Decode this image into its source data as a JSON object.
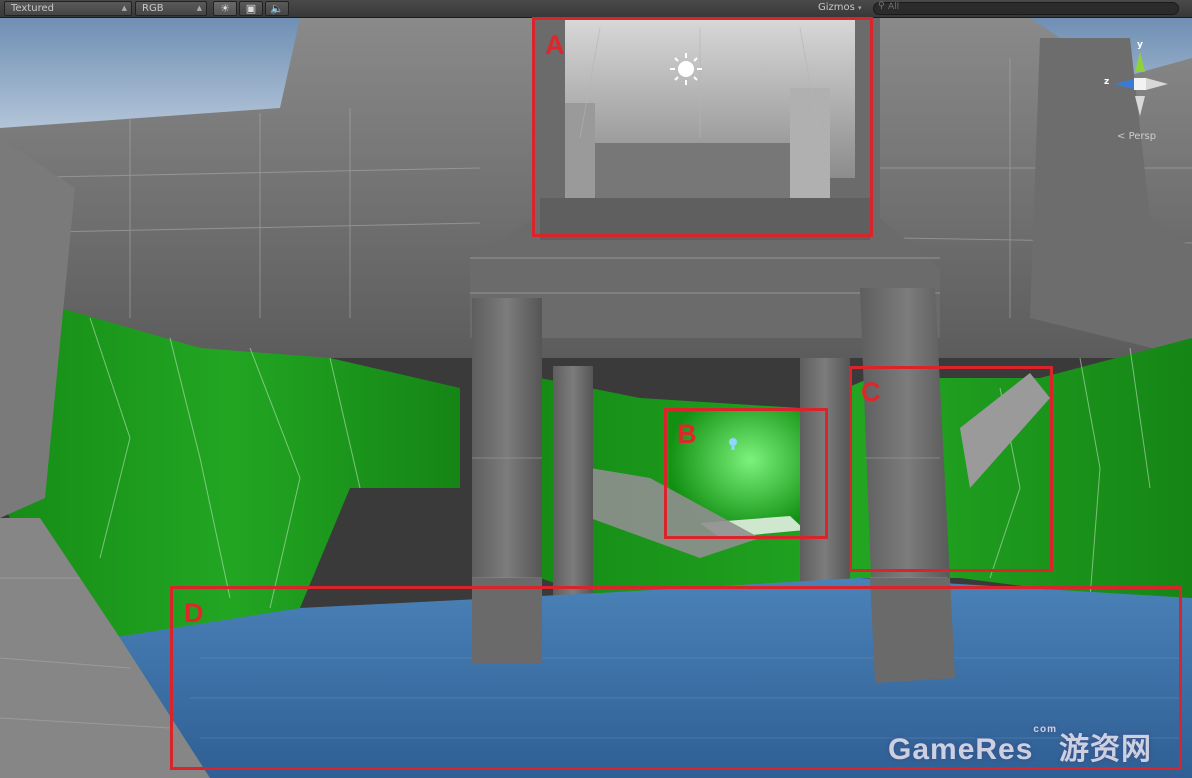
{
  "toolbar": {
    "render_mode": "Textured",
    "color_channel": "RGB",
    "lighting_icon": "sun-icon",
    "image_icon": "image-effects-icon",
    "audio_icon": "speaker-icon",
    "gizmos_label": "Gizmos",
    "search_placeholder": "All"
  },
  "scene": {
    "projection_label": "Persp",
    "axis_y": "y",
    "axis_z": "z",
    "colors": {
      "stone": "#7a7a7a",
      "moss": "#1f9a1f",
      "water": "#3b72a8",
      "sky": "#8fa9c6",
      "annotation": "#d8242a"
    }
  },
  "annotations": [
    {
      "label": "A"
    },
    {
      "label": "B"
    },
    {
      "label": "C"
    },
    {
      "label": "D"
    }
  ],
  "watermark": {
    "main": "GameRes",
    "small": "com",
    "chinese": "游资网"
  }
}
